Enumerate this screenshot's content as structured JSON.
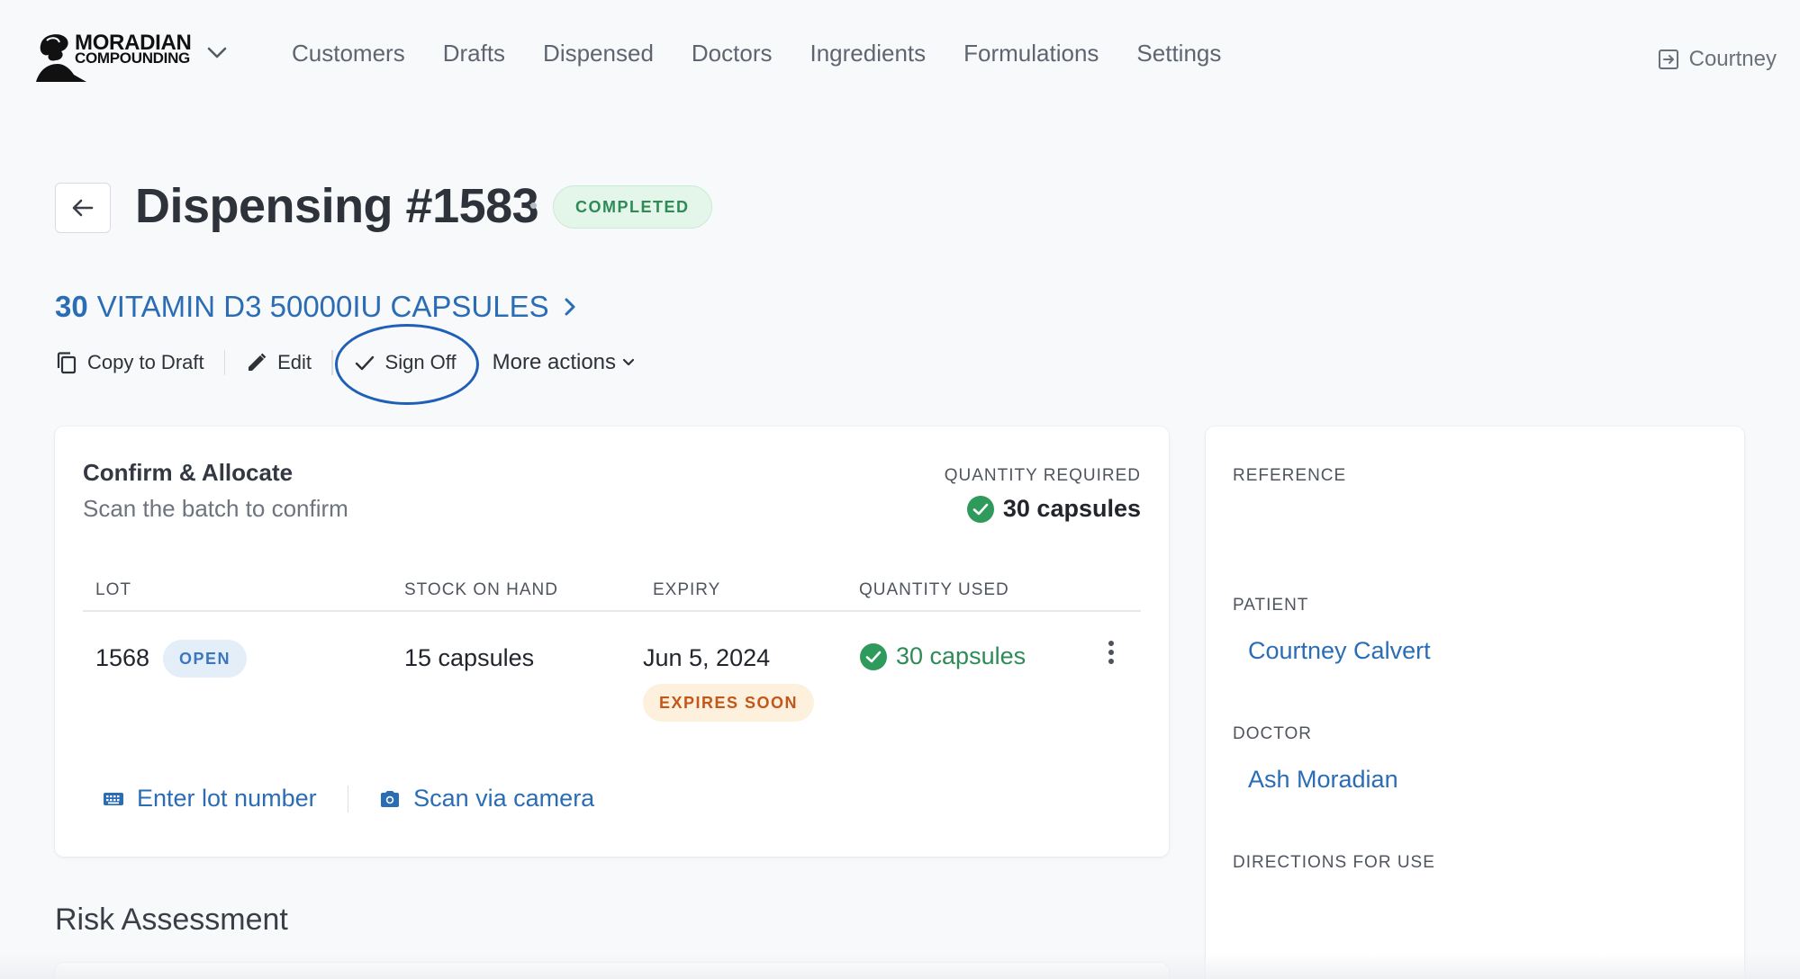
{
  "header": {
    "logo": {
      "line1": "MORADIAN",
      "line2": "COMPOUNDING"
    },
    "nav": [
      "Customers",
      "Drafts",
      "Dispensed",
      "Doctors",
      "Ingredients",
      "Formulations",
      "Settings"
    ],
    "user": "Courtney"
  },
  "page": {
    "title": "Dispensing #1583",
    "status": "COMPLETED",
    "product_qty": "30",
    "product_name": "VITAMIN D3 50000IU CAPSULES"
  },
  "actions": {
    "copy": "Copy to Draft",
    "edit": "Edit",
    "signoff": "Sign Off",
    "more": "More actions"
  },
  "allocate": {
    "title": "Confirm & Allocate",
    "subtitle": "Scan the batch to confirm",
    "qty_required_label": "QUANTITY REQUIRED",
    "qty_required_value": "30 capsules",
    "columns": {
      "lot": "LOT",
      "stock": "STOCK ON HAND",
      "expiry": "EXPIRY",
      "used": "QUANTITY USED"
    },
    "row": {
      "lot": "1568",
      "lot_badge": "OPEN",
      "stock": "15 capsules",
      "expiry": "Jun 5, 2024",
      "expiry_badge": "EXPIRES SOON",
      "used": "30 capsules"
    },
    "enter_lot": "Enter lot number",
    "scan_camera": "Scan via camera"
  },
  "risk": {
    "title": "Risk Assessment"
  },
  "side": {
    "reference_label": "REFERENCE",
    "patient_label": "PATIENT",
    "patient": "Courtney Calvert",
    "doctor_label": "DOCTOR",
    "doctor": "Ash Moradian",
    "directions_label": "DIRECTIONS FOR USE"
  },
  "colors": {
    "link": "#2a6db5",
    "success": "#2e8b57",
    "warning": "#c4561b",
    "annotation": "#1f5fb8"
  }
}
